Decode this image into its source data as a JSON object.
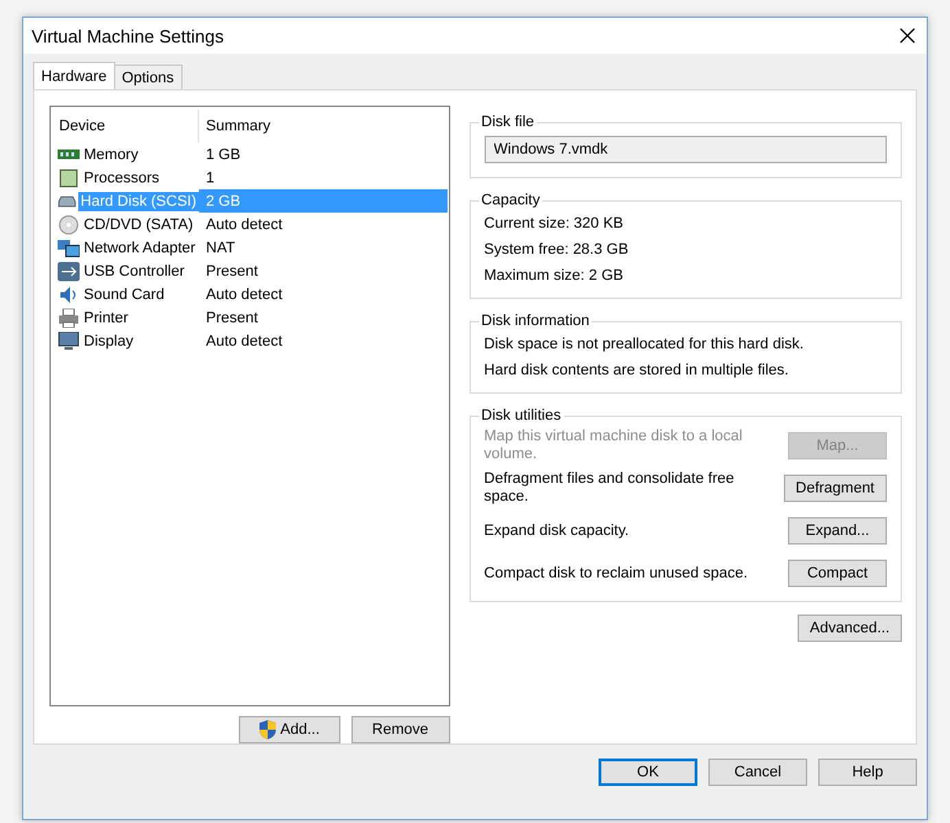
{
  "window": {
    "title": "Virtual Machine Settings"
  },
  "tabs": [
    {
      "label": "Hardware",
      "selected": true
    },
    {
      "label": "Options",
      "selected": false
    }
  ],
  "device_list": {
    "columns": [
      "Device",
      "Summary"
    ],
    "rows": [
      {
        "kind": "memory",
        "device": "Memory",
        "summary": "1 GB",
        "selected": false
      },
      {
        "kind": "processor",
        "device": "Processors",
        "summary": "1",
        "selected": false
      },
      {
        "kind": "disk",
        "device": "Hard Disk (SCSI)",
        "summary": "2 GB",
        "selected": true
      },
      {
        "kind": "cd",
        "device": "CD/DVD (SATA)",
        "summary": "Auto detect",
        "selected": false
      },
      {
        "kind": "network",
        "device": "Network Adapter",
        "summary": "NAT",
        "selected": false
      },
      {
        "kind": "usb",
        "device": "USB Controller",
        "summary": "Present",
        "selected": false
      },
      {
        "kind": "sound",
        "device": "Sound Card",
        "summary": "Auto detect",
        "selected": false
      },
      {
        "kind": "printer",
        "device": "Printer",
        "summary": "Present",
        "selected": false
      },
      {
        "kind": "display",
        "device": "Display",
        "summary": "Auto detect",
        "selected": false
      }
    ]
  },
  "list_buttons": [
    {
      "label": "Add...",
      "shield": true
    },
    {
      "label": "Remove",
      "shield": false
    }
  ],
  "disk_file": {
    "title": "Disk file",
    "value": "Windows 7.vmdk"
  },
  "capacity": {
    "title": "Capacity",
    "lines": [
      "Current size: 320 KB",
      "System free: 28.3 GB",
      "Maximum size: 2 GB"
    ]
  },
  "disk_information": {
    "title": "Disk information",
    "lines": [
      "Disk space is not preallocated for this hard disk.",
      "Hard disk contents are stored in multiple files."
    ]
  },
  "disk_utilities": {
    "title": "Disk utilities",
    "items": [
      {
        "text": "Map this virtual machine disk to a local volume.",
        "button": "Map...",
        "disabled": true
      },
      {
        "text": "Defragment files and consolidate free space.",
        "button": "Defragment",
        "disabled": false
      },
      {
        "text": "Expand disk capacity.",
        "button": "Expand...",
        "disabled": false
      },
      {
        "text": "Compact disk to reclaim unused space.",
        "button": "Compact",
        "disabled": false
      }
    ]
  },
  "advanced_button": "Advanced...",
  "dialog_buttons": [
    {
      "label": "OK",
      "default": true
    },
    {
      "label": "Cancel",
      "default": false
    },
    {
      "label": "Help",
      "default": false
    }
  ]
}
